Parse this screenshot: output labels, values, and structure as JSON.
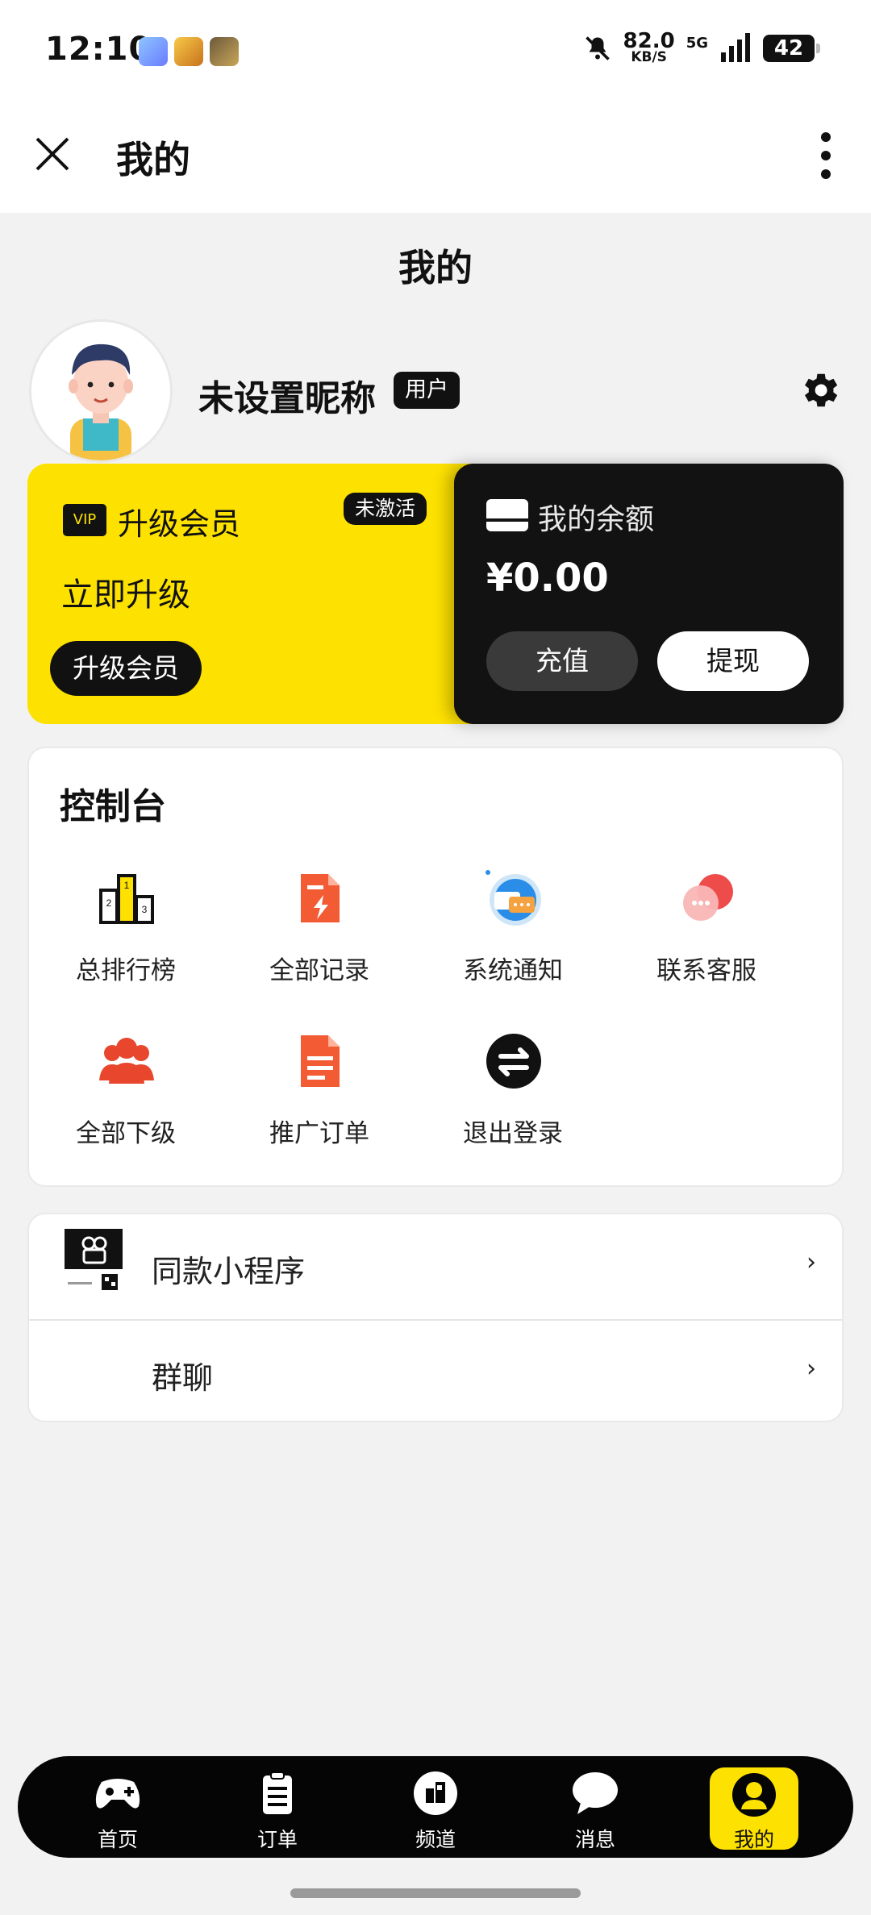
{
  "status_bar": {
    "time": "12:10",
    "speed_value": "82.0",
    "speed_unit": "KB/S",
    "network": "5G",
    "battery": "42"
  },
  "header": {
    "title": "我的"
  },
  "page": {
    "title": "我的"
  },
  "profile": {
    "nickname": "未设置昵称",
    "role_badge": "用户"
  },
  "vip_card": {
    "icon_text": "VIP",
    "label": "升级会员",
    "status": "未激活",
    "cta_text": "立即升级",
    "button_label": "升级会员",
    "accent_color": "#fde100"
  },
  "balance_card": {
    "label": "我的余额",
    "amount": "¥0.00",
    "recharge_label": "充值",
    "withdraw_label": "提现"
  },
  "console": {
    "title": "控制台",
    "items": [
      {
        "label": "总排行榜",
        "icon": "podium-icon"
      },
      {
        "label": "全部记录",
        "icon": "record-icon"
      },
      {
        "label": "系统通知",
        "icon": "notification-icon"
      },
      {
        "label": "联系客服",
        "icon": "chat-bubbles-icon"
      },
      {
        "label": "全部下级",
        "icon": "group-icon"
      },
      {
        "label": "推广订单",
        "icon": "document-icon"
      },
      {
        "label": "退出登录",
        "icon": "logout-swap-icon"
      }
    ]
  },
  "menu": {
    "items": [
      {
        "label": "同款小程序",
        "arrow": "›"
      },
      {
        "label": "群聊",
        "arrow": "›"
      }
    ]
  },
  "bottom_nav": {
    "items": [
      {
        "label": "首页",
        "icon": "gamepad-icon"
      },
      {
        "label": "订单",
        "icon": "clipboard-icon"
      },
      {
        "label": "频道",
        "icon": "channel-icon"
      },
      {
        "label": "消息",
        "icon": "message-icon"
      },
      {
        "label": "我的",
        "icon": "user-icon",
        "active": true
      }
    ]
  }
}
